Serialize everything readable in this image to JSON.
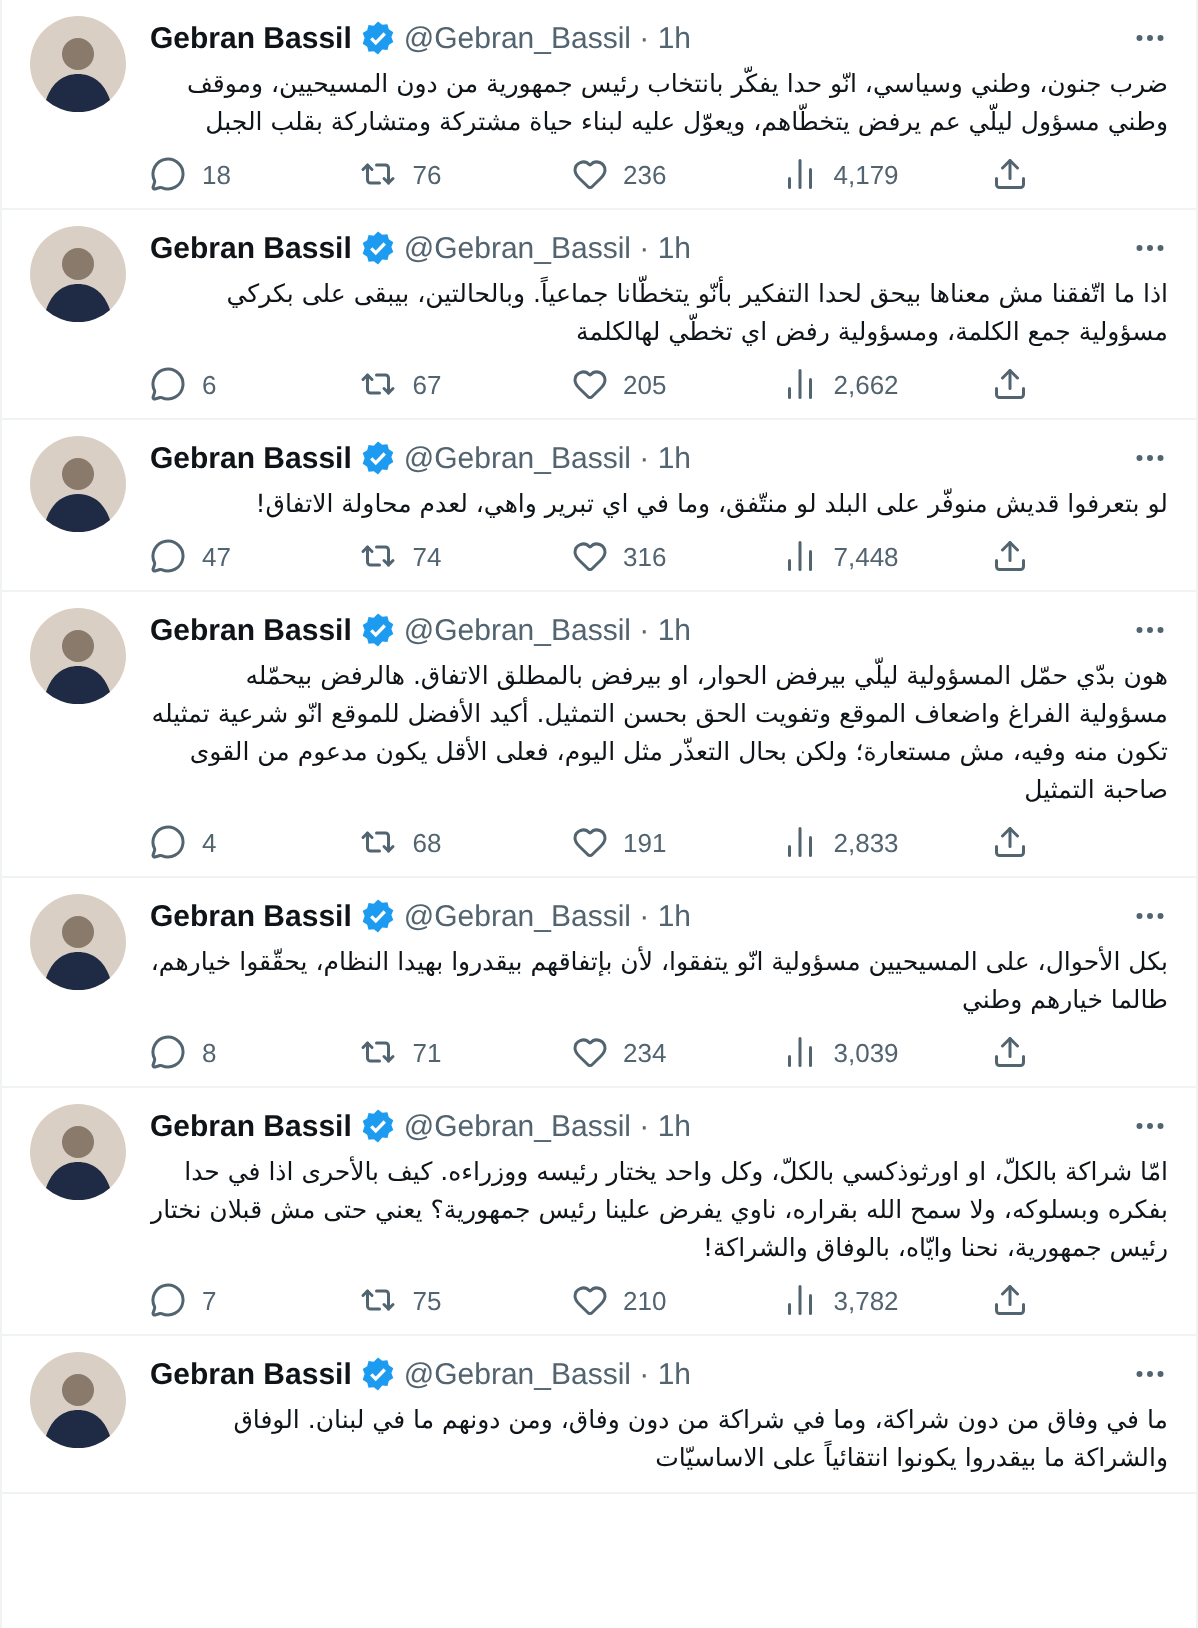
{
  "tweets": [
    {
      "name": "Gebran Bassil",
      "verified": true,
      "meta": "@Gebran_Bassil · 1h",
      "text": "ضرب جنون، وطني وسياسي، انّو حدا يفكّر بانتخاب رئيس جمهورية من دون المسيحيين، وموقف وطني مسؤول ليلّي عم يرفض يتخطّاهم، ويعوّل عليه لبناء حياة مشتركة ومتشاركة بقلب الجبل",
      "actions": {
        "replies": "18",
        "retweets": "76",
        "likes": "236",
        "views": "4,179"
      }
    },
    {
      "name": "Gebran Bassil",
      "verified": true,
      "meta": "@Gebran_Bassil · 1h",
      "text": "اذا ما اتّفقنا مش معناها بيحق لحدا التفكير بأنّو يتخطّانا جماعياً. وبالحالتين، بيبقى على بكركي مسؤولية جمع الكلمة، ومسؤولية رفض اي تخطّي لهالكلمة",
      "actions": {
        "replies": "6",
        "retweets": "67",
        "likes": "205",
        "views": "2,662"
      }
    },
    {
      "name": "Gebran Bassil",
      "verified": true,
      "meta": "@Gebran_Bassil · 1h",
      "text": "لو بتعرفوا قديش منوفّر على البلد لو منتّفق، وما في اي تبرير واهي، لعدم محاولة الاتفاق!",
      "actions": {
        "replies": "47",
        "retweets": "74",
        "likes": "316",
        "views": "7,448"
      }
    },
    {
      "name": "Gebran Bassil",
      "verified": true,
      "meta": "@Gebran_Bassil · 1h",
      "text": "هون بدّي حمّل المسؤولية ليلّي بيرفض الحوار، او بيرفض بالمطلق الاتفاق. هالرفض بيحمّله مسؤولية الفراغ واضعاف الموقع وتفويت الحق بحسن التمثيل. أكيد الأفضل للموقع انّو شرعية تمثيله تكون منه وفيه، مش مستعارة؛ ولكن بحال التعذّر مثل اليوم، فعلى الأقل يكون مدعوم من القوى صاحبة التمثيل",
      "actions": {
        "replies": "4",
        "retweets": "68",
        "likes": "191",
        "views": "2,833"
      }
    },
    {
      "name": "Gebran Bassil",
      "verified": true,
      "meta": "@Gebran_Bassil · 1h",
      "text": "بكل الأحوال، على المسيحيين مسؤولية انّو يتفقوا، لأن بإتفاقهم بيقدروا بهيدا النظام،  يحقّقوا خيارهم، طالما خيارهم وطني",
      "actions": {
        "replies": "8",
        "retweets": "71",
        "likes": "234",
        "views": "3,039"
      }
    },
    {
      "name": "Gebran Bassil",
      "verified": true,
      "meta": "@Gebran_Bassil · 1h",
      "text": "امّا شراكة بالكلّ، او اورثوذكسي بالكلّ، وكل واحد يختار رئيسه ووزراءه. كيف بالأحرى اذا في حدا بفكره وبسلوكه، ولا سمح الله بقراره، ناوي يفرض علينا رئيس جمهورية؟ يعني حتى مش قبلان نختار رئيس جمهورية، نحنا وايّاه، بالوفاق والشراكة!",
      "actions": {
        "replies": "7",
        "retweets": "75",
        "likes": "210",
        "views": "3,782"
      }
    },
    {
      "name": "Gebran Bassil",
      "verified": true,
      "meta": "@Gebran_Bassil · 1h",
      "text": "ما في وفاق من دون شراكة، وما في شراكة من دون وفاق، ومن دونهم ما في لبنان. الوفاق والشراكة ما بيقدروا يكونوا انتقائياً على الاساسيّات"
    }
  ]
}
